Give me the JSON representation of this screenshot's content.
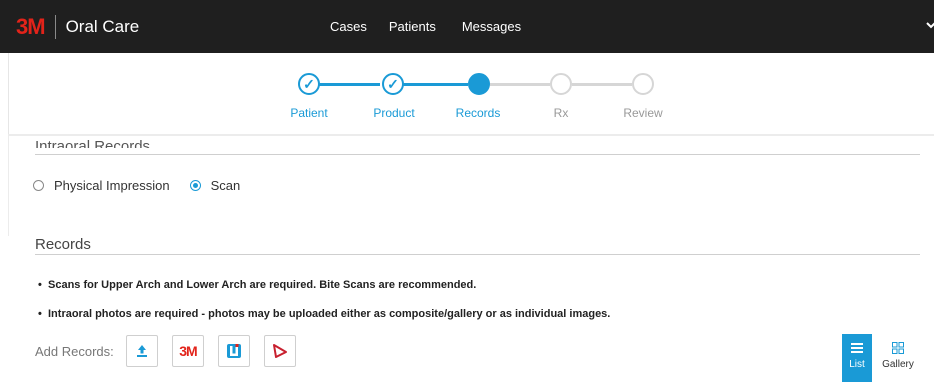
{
  "header": {
    "logo_text": "3M",
    "brand": "Oral Care",
    "nav": [
      "Cases",
      "Patients",
      "Messages"
    ],
    "brand_red": "#e2231a"
  },
  "stepper": {
    "steps": [
      {
        "label": "Patient",
        "state": "done"
      },
      {
        "label": "Product",
        "state": "done"
      },
      {
        "label": "Records",
        "state": "current"
      },
      {
        "label": "Rx",
        "state": "todo"
      },
      {
        "label": "Review",
        "state": "todo"
      }
    ],
    "active_color": "#1a9ad6",
    "inactive_color": "#d6d6d6"
  },
  "intraoral": {
    "title": "Intraoral Records",
    "options": [
      {
        "label": "Physical Impression",
        "checked": false
      },
      {
        "label": "Scan",
        "checked": true
      }
    ]
  },
  "records": {
    "title": "Records",
    "notes": [
      "Scans for Upper Arch and Lower Arch are required. Bite Scans are recommended.",
      "Intraoral photos are required - photos may be uploaded either as composite/gallery or as individual images."
    ],
    "add_label": "Add Records:",
    "add_buttons": [
      "upload-icon",
      "3m-logo",
      "itero-icon",
      "trios-icon"
    ],
    "btn_3m_text": "3M"
  },
  "view_toggle": {
    "list": "List",
    "gallery": "Gallery",
    "selected": "List"
  }
}
